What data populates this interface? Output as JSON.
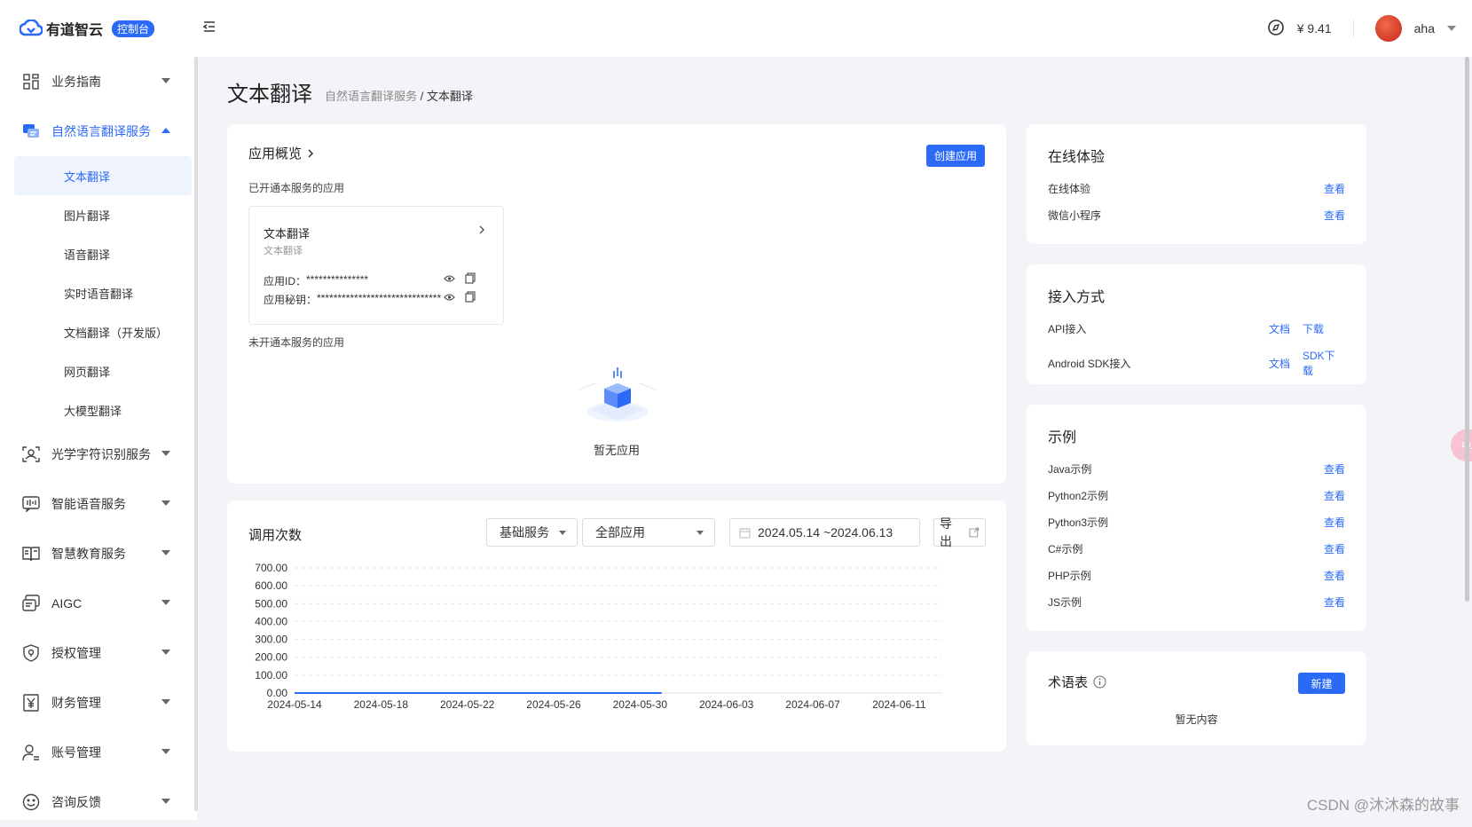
{
  "header": {
    "brand": "有道智云",
    "badge": "控制台",
    "balance": "¥ 9.41",
    "username": "aha"
  },
  "sidebar": {
    "groups": [
      {
        "label": "业务指南",
        "icon": "grid-icon"
      },
      {
        "label": "自然语言翻译服务",
        "icon": "translate-chat-icon",
        "open": true,
        "items": [
          "文本翻译",
          "图片翻译",
          "语音翻译",
          "实时语音翻译",
          "文档翻译（开发版）",
          "网页翻译",
          "大模型翻译"
        ]
      },
      {
        "label": "光学字符识别服务",
        "icon": "scan-icon"
      },
      {
        "label": "智能语音服务",
        "icon": "voice-icon"
      },
      {
        "label": "智慧教育服务",
        "icon": "book-icon"
      },
      {
        "label": "AIGC",
        "icon": "aigc-icon"
      },
      {
        "label": "授权管理",
        "icon": "shield-icon"
      },
      {
        "label": "财务管理",
        "icon": "yuan-icon"
      },
      {
        "label": "账号管理",
        "icon": "user-icon"
      },
      {
        "label": "咨询反馈",
        "icon": "smile-icon"
      }
    ]
  },
  "page": {
    "title": "文本翻译",
    "breadcrumb_parent": "自然语言翻译服务",
    "breadcrumb_sep": "/",
    "breadcrumb_current": "文本翻译"
  },
  "overview": {
    "title": "应用概览",
    "create_button": "创建应用",
    "enabled_label": "已开通本服务的应用",
    "app_name": "文本翻译",
    "app_sub": "文本翻译",
    "app_id_label": "应用ID：",
    "app_id_value": "***************",
    "app_secret_label": "应用秘钥：",
    "app_secret_value": "******************************",
    "disabled_label": "未开通本服务的应用",
    "empty_text": "暂无应用"
  },
  "calls": {
    "title": "调用次数",
    "service_select": "基础服务",
    "app_select": "全部应用",
    "date_range": "2024.05.14 ~2024.06.13",
    "export": "导出"
  },
  "chart_data": {
    "type": "line",
    "title": "",
    "x_ticks": [
      "2024-05-14",
      "2024-05-18",
      "2024-05-22",
      "2024-05-26",
      "2024-05-30",
      "2024-06-03",
      "2024-06-07",
      "2024-06-11"
    ],
    "y_ticks": [
      "700.00",
      "600.00",
      "500.00",
      "400.00",
      "300.00",
      "200.00",
      "100.00",
      "0.00"
    ],
    "ylim": [
      0,
      700
    ],
    "x_range": [
      "2024-05-14",
      "2024-06-13"
    ],
    "series": [
      {
        "color": "#2b6af7",
        "x": [
          "2024-05-14",
          "2024-05-31"
        ],
        "y": [
          0,
          0
        ]
      }
    ],
    "grid": true
  },
  "online": {
    "title": "在线体验",
    "rows": [
      {
        "label": "在线体验",
        "link": "查看"
      },
      {
        "label": "微信小程序",
        "link": "查看"
      }
    ]
  },
  "access": {
    "title": "接入方式",
    "rows": [
      {
        "label": "API接入",
        "link1": "文档",
        "link2": "下载"
      },
      {
        "label": "Android SDK接入",
        "link1": "文档",
        "link2": "SDK下载"
      }
    ]
  },
  "examples": {
    "title": "示例",
    "rows": [
      {
        "label": "Java示例",
        "link": "查看"
      },
      {
        "label": "Python2示例",
        "link": "查看"
      },
      {
        "label": "Python3示例",
        "link": "查看"
      },
      {
        "label": "C#示例",
        "link": "查看"
      },
      {
        "label": "PHP示例",
        "link": "查看"
      },
      {
        "label": "JS示例",
        "link": "查看"
      }
    ]
  },
  "glossary": {
    "title": "术语表",
    "new_button": "新建",
    "empty_text": "暂无内容"
  },
  "float_button": "中A",
  "watermark": "CSDN @沐沐森的故事",
  "colors": {
    "accent": "#2b6af7",
    "background": "#f3f4f8"
  }
}
